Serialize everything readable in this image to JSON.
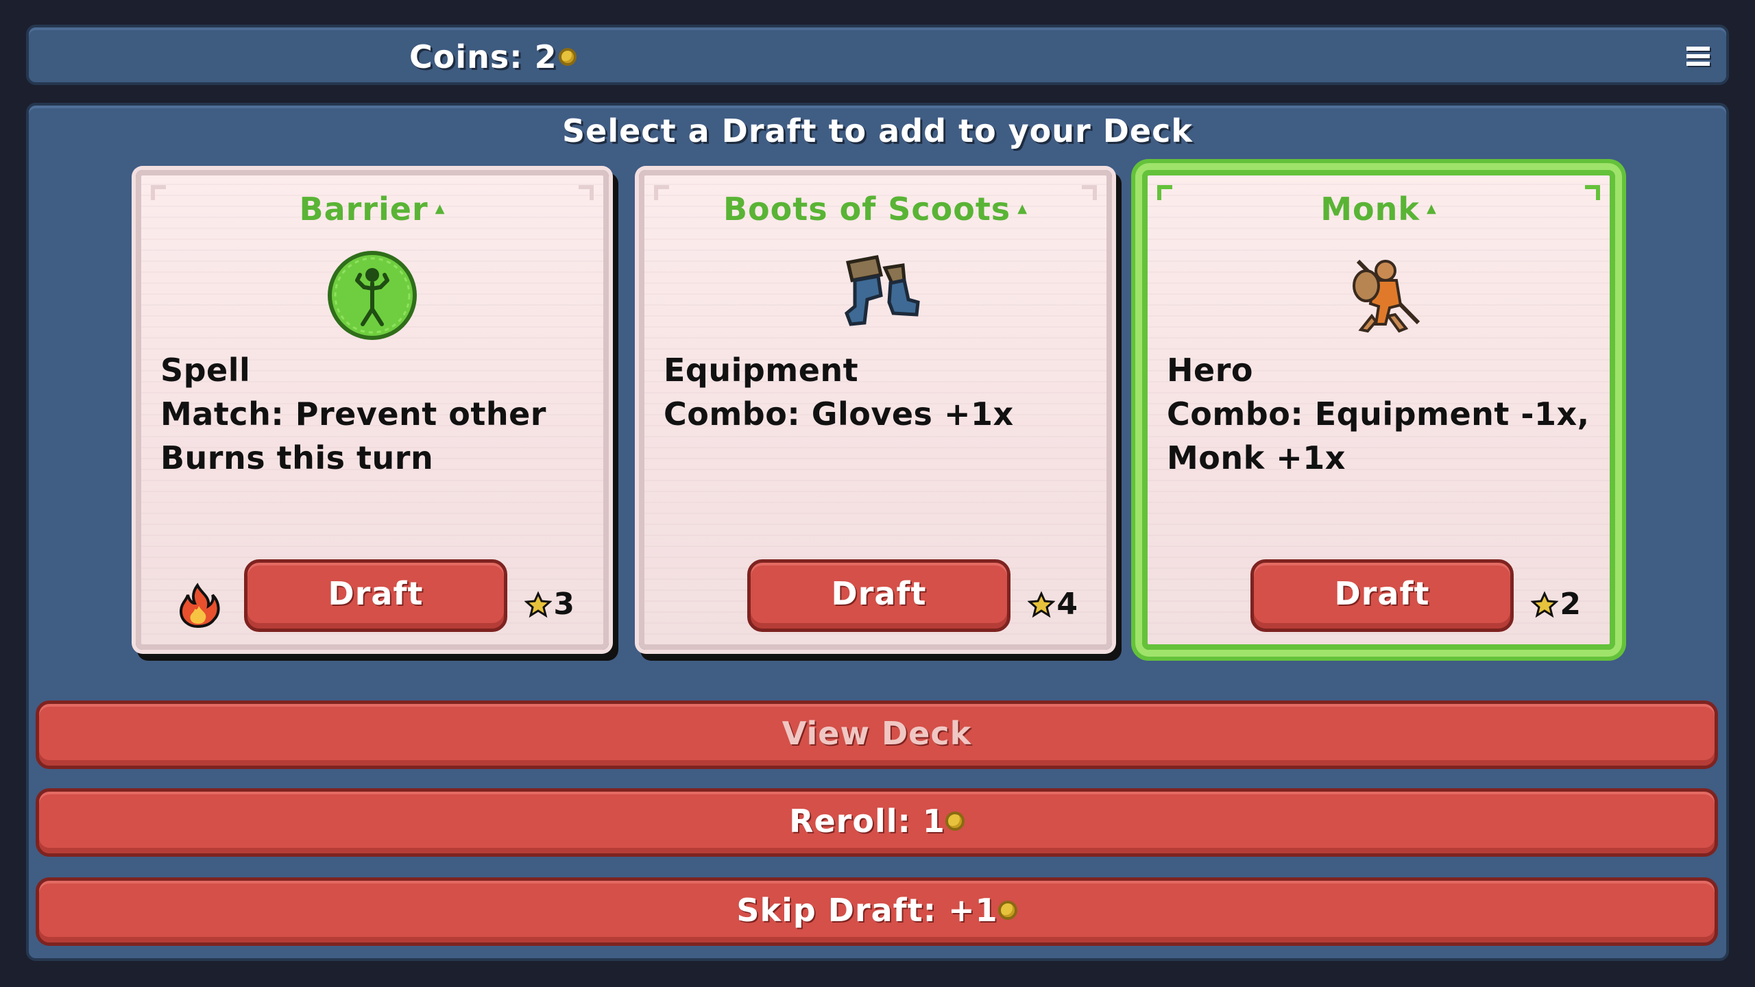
{
  "header": {
    "coins_label": "Coins: 2",
    "coin_icon": "coin-icon",
    "menu_icon": "menu-icon"
  },
  "main": {
    "heading": "Select a Draft to add to your Deck",
    "cards": [
      {
        "title": "Barrier",
        "art_icon": "barrier-spell-icon",
        "type": "Spell",
        "lines": [
          "Match: Prevent other",
          "Burns this turn"
        ],
        "button_label": "Draft",
        "cost": "3",
        "extra_icon": "fire-icon",
        "selected": false
      },
      {
        "title": "Boots of Scoots",
        "art_icon": "boots-icon",
        "type": "Equipment",
        "lines": [
          "Combo: Gloves +1x"
        ],
        "button_label": "Draft",
        "cost": "4",
        "selected": false
      },
      {
        "title": "Monk",
        "art_icon": "monk-hero-icon",
        "type": "Hero",
        "lines": [
          "Combo: Equipment -1x,",
          "Monk +1x"
        ],
        "button_label": "Draft",
        "cost": "2",
        "selected": true
      }
    ]
  },
  "actions": {
    "view_deck": "View Deck",
    "reroll": "Reroll: 1",
    "skip_draft": "Skip Draft: +1"
  },
  "colors": {
    "title_green": "#59b435",
    "button_red": "#d45049",
    "panel_blue": "#405d84",
    "selected_border": "#64c23a"
  }
}
